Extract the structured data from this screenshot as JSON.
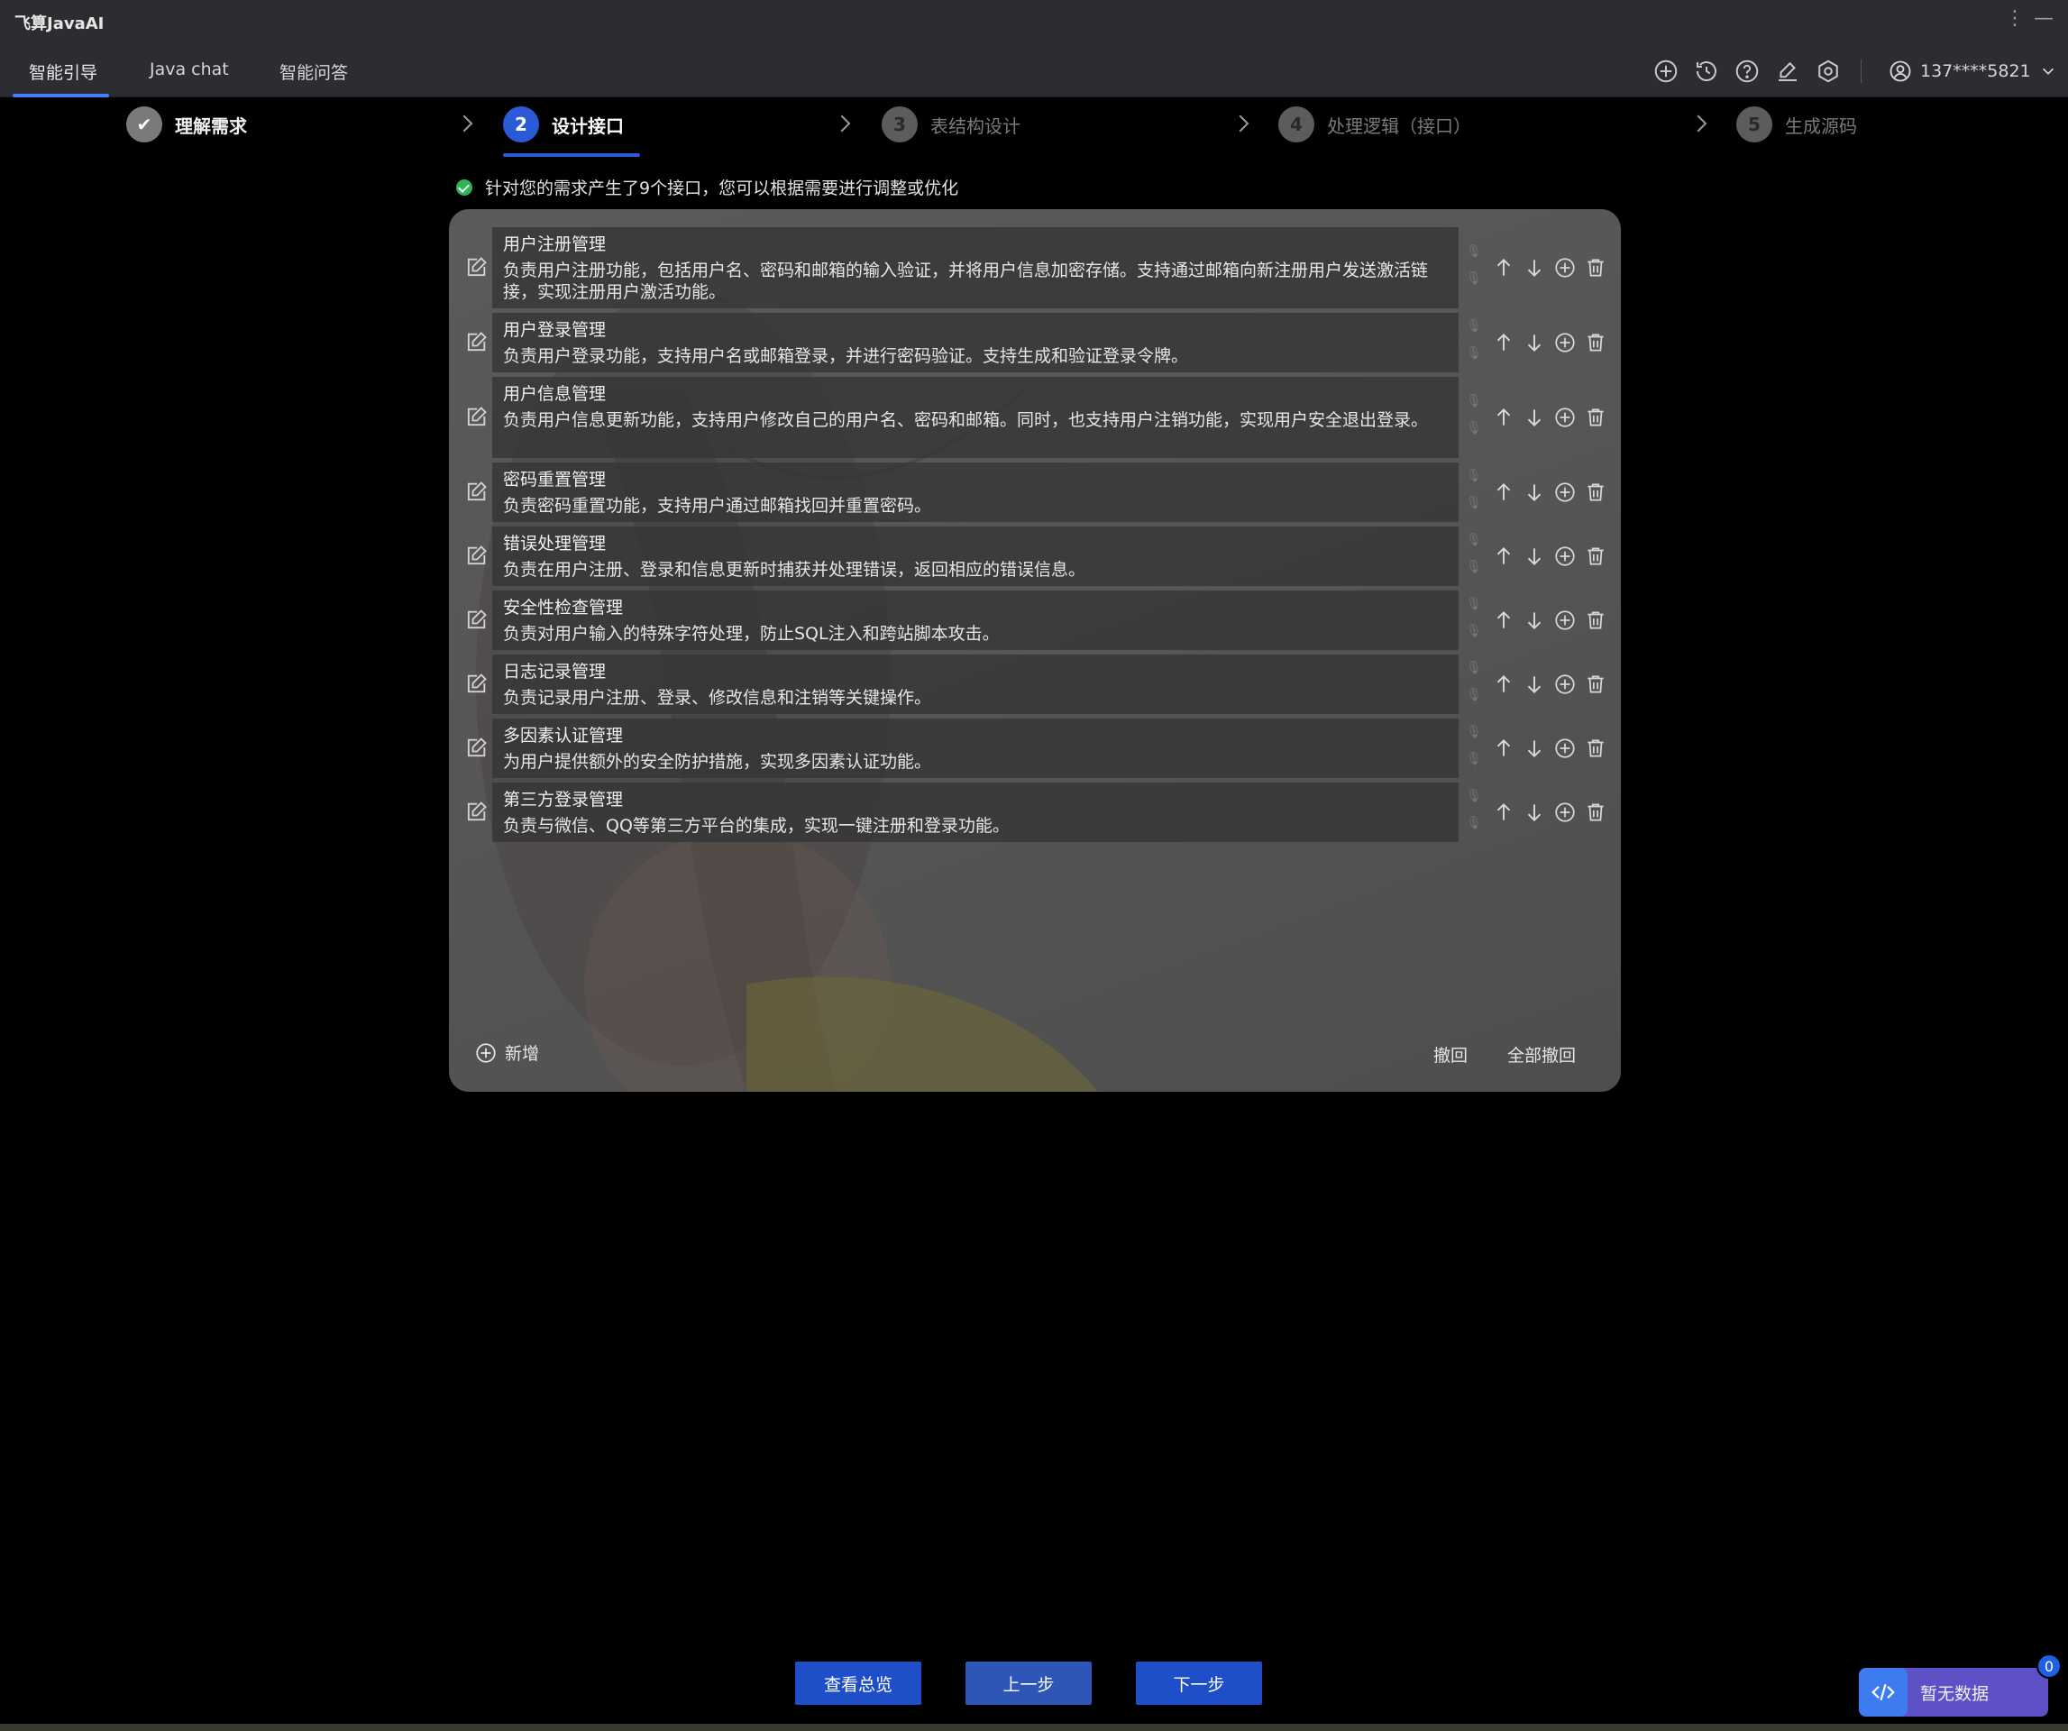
{
  "app": {
    "title": "飞算JavaAI"
  },
  "tabs": [
    {
      "label": "智能引导",
      "active": true
    },
    {
      "label": "Java chat",
      "active": false
    },
    {
      "label": "智能问答",
      "active": false
    }
  ],
  "toolbar_icons": [
    "add-circle-icon",
    "history-icon",
    "help-icon",
    "edit-icon",
    "settings-icon"
  ],
  "user": {
    "name": "137****5821"
  },
  "steps": [
    {
      "number": "✔",
      "label": "理解需求",
      "state": "done"
    },
    {
      "number": "2",
      "label": "设计接口",
      "state": "active"
    },
    {
      "number": "3",
      "label": "表结构设计",
      "state": "todo"
    },
    {
      "number": "4",
      "label": "处理逻辑（接口）",
      "state": "todo"
    },
    {
      "number": "5",
      "label": "生成源码",
      "state": "todo"
    }
  ],
  "notice": {
    "text": "针对您的需求产生了9个接口，您可以根据需要进行调整或优化"
  },
  "interfaces": [
    {
      "title": "用户注册管理",
      "desc": "负责用户注册功能，包括用户名、密码和邮箱的输入验证，并将用户信息加密存储。支持通过邮箱向新注册用户发送激活链接，实现注册用户激活功能。"
    },
    {
      "title": "用户登录管理",
      "desc": "负责用户登录功能，支持用户名或邮箱登录，并进行密码验证。支持生成和验证登录令牌。"
    },
    {
      "title": "用户信息管理",
      "desc": "负责用户信息更新功能，支持用户修改自己的用户名、密码和邮箱。同时，也支持用户注销功能，实现用户安全退出登录。"
    },
    {
      "title": "密码重置管理",
      "desc": "负责密码重置功能，支持用户通过邮箱找回并重置密码。"
    },
    {
      "title": "错误处理管理",
      "desc": "负责在用户注册、登录和信息更新时捕获并处理错误，返回相应的错误信息。"
    },
    {
      "title": "安全性检查管理",
      "desc": "负责对用户输入的特殊字符处理，防止SQL注入和跨站脚本攻击。"
    },
    {
      "title": "日志记录管理",
      "desc": "负责记录用户注册、登录、修改信息和注销等关键操作。"
    },
    {
      "title": "多因素认证管理",
      "desc": "为用户提供额外的安全防护措施，实现多因素认证功能。"
    },
    {
      "title": "第三方登录管理",
      "desc": "负责与微信、QQ等第三方平台的集成，实现一键注册和登录功能。"
    }
  ],
  "panel_actions": {
    "add_label": "新增",
    "undo_label": "撤回",
    "undo_all_label": "全部撤回"
  },
  "buttons": {
    "overview": "查看总览",
    "prev": "上一步",
    "next": "下一步"
  },
  "floater": {
    "label": "暂无数据",
    "badge": "0"
  },
  "colors": {
    "accent": "#2a5ad6",
    "success": "#2fb457",
    "panel": "#565656",
    "background": "#000000"
  }
}
